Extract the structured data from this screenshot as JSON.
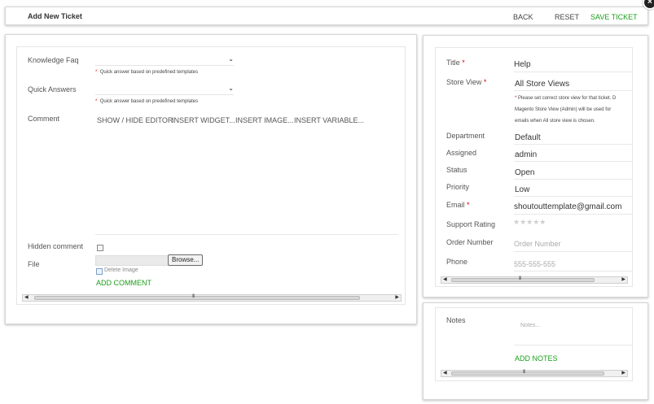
{
  "header": {
    "title": "Add New Ticket",
    "back": "BACK",
    "reset": "RESET",
    "save": "SAVE TICKET"
  },
  "close_icon": "×",
  "left": {
    "knowledge_faq": {
      "label": "Knowledge Faq",
      "value": "",
      "hint": "Quick answer based on predefined templates"
    },
    "quick_answers": {
      "label": "Quick Answers",
      "value": "",
      "hint": "Quick answer based on predefined templates"
    },
    "comment": {
      "label": "Comment",
      "toolbar": [
        "SHOW / HIDE EDITOR",
        "INSERT WIDGET...",
        "INSERT IMAGE...",
        "INSERT VARIABLE..."
      ]
    },
    "hidden_comment": {
      "label": "Hidden comment"
    },
    "file": {
      "label": "File",
      "browse": "Browse...",
      "delete_image": "Delete Image"
    },
    "add_comment": "ADD COMMENT",
    "scroll_grip": "III"
  },
  "right": {
    "title": {
      "label": "Title",
      "value": "Help"
    },
    "store_view": {
      "label": "Store View",
      "value": "All Store Views",
      "hint_lines": [
        "Please set correct store view for that ticket. D",
        "Magento Store View (Admin) will be used for",
        "emails when All store view is chosen."
      ]
    },
    "department": {
      "label": "Department",
      "value": "Default"
    },
    "assigned": {
      "label": "Assigned",
      "value": "admin"
    },
    "status": {
      "label": "Status",
      "value": "Open"
    },
    "priority": {
      "label": "Priority",
      "value": "Low"
    },
    "email": {
      "label": "Email",
      "value": "shoutouttemplate@gmail.com"
    },
    "support_rating": {
      "label": "Support Rating",
      "rating": 0,
      "max": 5,
      "star_glyphs": "★★★★★"
    },
    "order_number": {
      "label": "Order Number",
      "placeholder": "Order Number"
    },
    "phone": {
      "label": "Phone",
      "placeholder": "555-555-555"
    },
    "scroll_grip": "III"
  },
  "notes": {
    "label": "Notes",
    "placeholder": "Notes...",
    "add": "ADD NOTES",
    "scroll_grip": "III"
  },
  "required_mark": "*",
  "hint_mark": "*",
  "colors": {
    "green": "#1a9f1a",
    "required": "#dd0000"
  }
}
